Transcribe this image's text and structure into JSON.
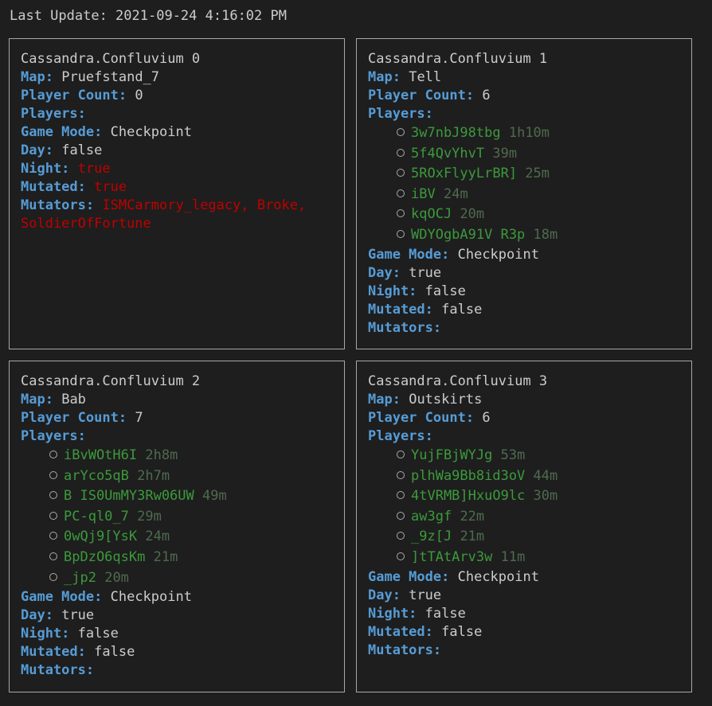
{
  "last_update": "Last Update: 2021-09-24 4:16:02 PM",
  "labels": {
    "map": "Map:",
    "player_count": "Player Count:",
    "players": "Players:",
    "game_mode": "Game Mode:",
    "day": "Day:",
    "night": "Night:",
    "mutated": "Mutated:",
    "mutators": "Mutators:"
  },
  "servers": [
    {
      "name": "Cassandra.Confluvium 0",
      "map": "Pruefstand_7",
      "player_count": "0",
      "players": [],
      "game_mode": "Checkpoint",
      "day": "false",
      "night": "true",
      "mutated": "true",
      "mutators": "ISMCarmory_legacy, Broke, SoldierOfFortune"
    },
    {
      "name": "Cassandra.Confluvium 1",
      "map": "Tell",
      "player_count": "6",
      "players": [
        {
          "name": "3w7nbJ98tbg",
          "time": "1h10m"
        },
        {
          "name": "5f4QvYhvT",
          "time": "39m"
        },
        {
          "name": "5ROxFlyyLrBR]",
          "time": "25m"
        },
        {
          "name": "iBV",
          "time": "24m"
        },
        {
          "name": "kqOCJ",
          "time": "20m"
        },
        {
          "name": "WDYOgbA91V R3p",
          "time": "18m"
        }
      ],
      "game_mode": "Checkpoint",
      "day": "true",
      "night": "false",
      "mutated": "false",
      "mutators": ""
    },
    {
      "name": "Cassandra.Confluvium 2",
      "map": "Bab",
      "player_count": "7",
      "players": [
        {
          "name": "iBvWOtH6I",
          "time": "2h8m"
        },
        {
          "name": "arYco5qB",
          "time": "2h7m"
        },
        {
          "name": "B IS0UmMY3Rw06UW",
          "time": "49m"
        },
        {
          "name": "PC-ql0_7",
          "time": "29m"
        },
        {
          "name": "0wQj9[YsK",
          "time": "24m"
        },
        {
          "name": "BpDzO6qsKm",
          "time": "21m"
        },
        {
          "name": "_jp2",
          "time": "20m"
        }
      ],
      "game_mode": "Checkpoint",
      "day": "true",
      "night": "false",
      "mutated": "false",
      "mutators": ""
    },
    {
      "name": "Cassandra.Confluvium 3",
      "map": "Outskirts",
      "player_count": "6",
      "players": [
        {
          "name": "YujFBjWYJg",
          "time": "53m"
        },
        {
          "name": "plhWa9Bb8id3oV",
          "time": "44m"
        },
        {
          "name": "4tVRMB]HxuO9lc",
          "time": "30m"
        },
        {
          "name": "aw3gf",
          "time": "22m"
        },
        {
          "name": "_9z[J",
          "time": "21m"
        },
        {
          "name": "]tTAtArv3w",
          "time": "11m"
        }
      ],
      "game_mode": "Checkpoint",
      "day": "true",
      "night": "false",
      "mutated": "false",
      "mutators": ""
    }
  ],
  "colors": {
    "background": "#1e1e1e",
    "text": "#cccccc",
    "key": "#569cd6",
    "alert": "#c00000",
    "player_name": "#3c9a3c",
    "player_time": "#4f6a4f",
    "border": "#a8a8a8"
  }
}
